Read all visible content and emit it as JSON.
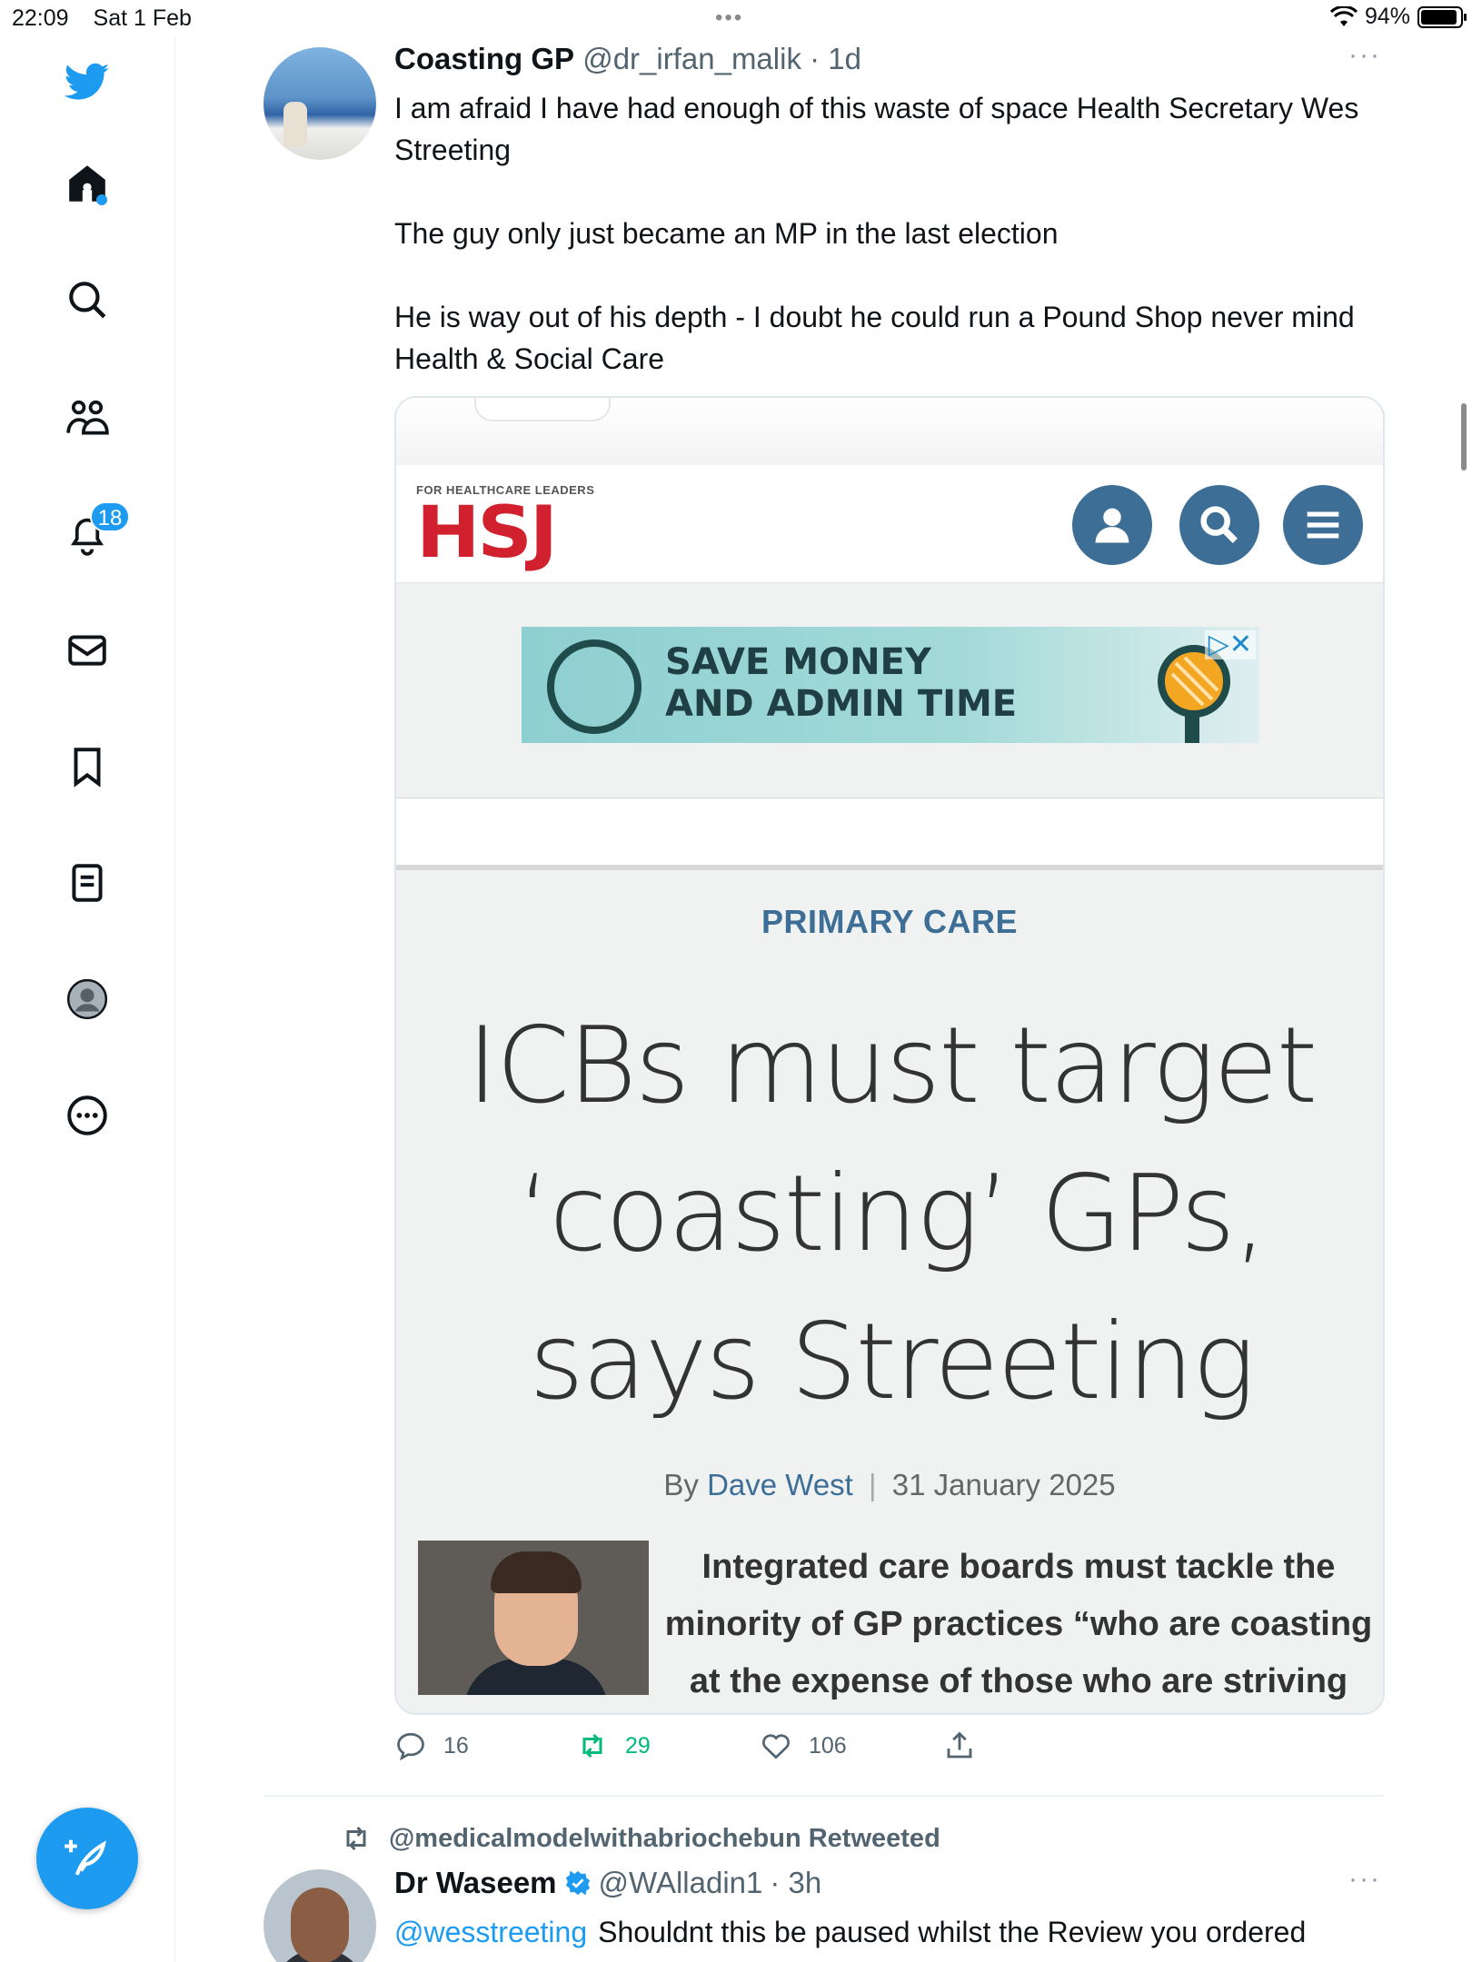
{
  "status_bar": {
    "time": "22:09",
    "date": "Sat 1 Feb",
    "dots": "•••",
    "battery": "94%",
    "battery_level": 0.94
  },
  "sidebar": {
    "items": [
      {
        "name": "twitter-logo",
        "icon": "bird-icon"
      },
      {
        "name": "home",
        "icon": "home-icon"
      },
      {
        "name": "explore",
        "icon": "search-icon"
      },
      {
        "name": "communities",
        "icon": "people-icon"
      },
      {
        "name": "notifications",
        "icon": "bell-icon",
        "badge": "18"
      },
      {
        "name": "messages",
        "icon": "mail-icon"
      },
      {
        "name": "bookmarks",
        "icon": "bookmark-icon"
      },
      {
        "name": "lists",
        "icon": "list-icon"
      },
      {
        "name": "profile",
        "icon": "avatar-icon"
      },
      {
        "name": "more",
        "icon": "more-circle-icon"
      }
    ],
    "compose_icon": "feather-plus-icon",
    "accent": "#1d9bf0"
  },
  "tweet1": {
    "name": "Coasting GP",
    "handle": "@dr_irfan_malik",
    "time": "· 1d",
    "more": "···",
    "text_lines": [
      "I am afraid I have had enough of this waste of space Health Secretary Wes Streeting",
      "The guy only just became an MP in the last election",
      "He is way out of his depth - I doubt he could run a Pound Shop never mind Health & Social Care"
    ],
    "card": {
      "tagline": "FOR HEALTHCARE LEADERS",
      "logo": "HSJ",
      "ad_line1": "SAVE MONEY",
      "ad_line2": "AND ADMIN TIME",
      "ad_close": "▷✕",
      "section": "PRIMARY CARE",
      "headline": "ICBs must target ‘coasting’ GPs, says Streeting",
      "by": "By",
      "author": "Dave West",
      "separator": "|",
      "date": "31 January 2025",
      "lede": "Integrated care boards must tackle the minority of GP practices “who are coasting at the expense of those who are striving",
      "brand_color": "#d1202e",
      "button_color": "#3d6e96"
    },
    "actions": {
      "replies": "16",
      "retweets": "29",
      "likes": "106"
    }
  },
  "tweet2": {
    "retweeted_by": "@medicalmodelwithabriochebun Retweeted",
    "name": "Dr Waseem",
    "handle": "@WAlladin1",
    "time": "· 3h",
    "more": "···",
    "mention": "@wesstreeting",
    "text": "Shouldnt this be paused whilst the Review you ordered"
  }
}
